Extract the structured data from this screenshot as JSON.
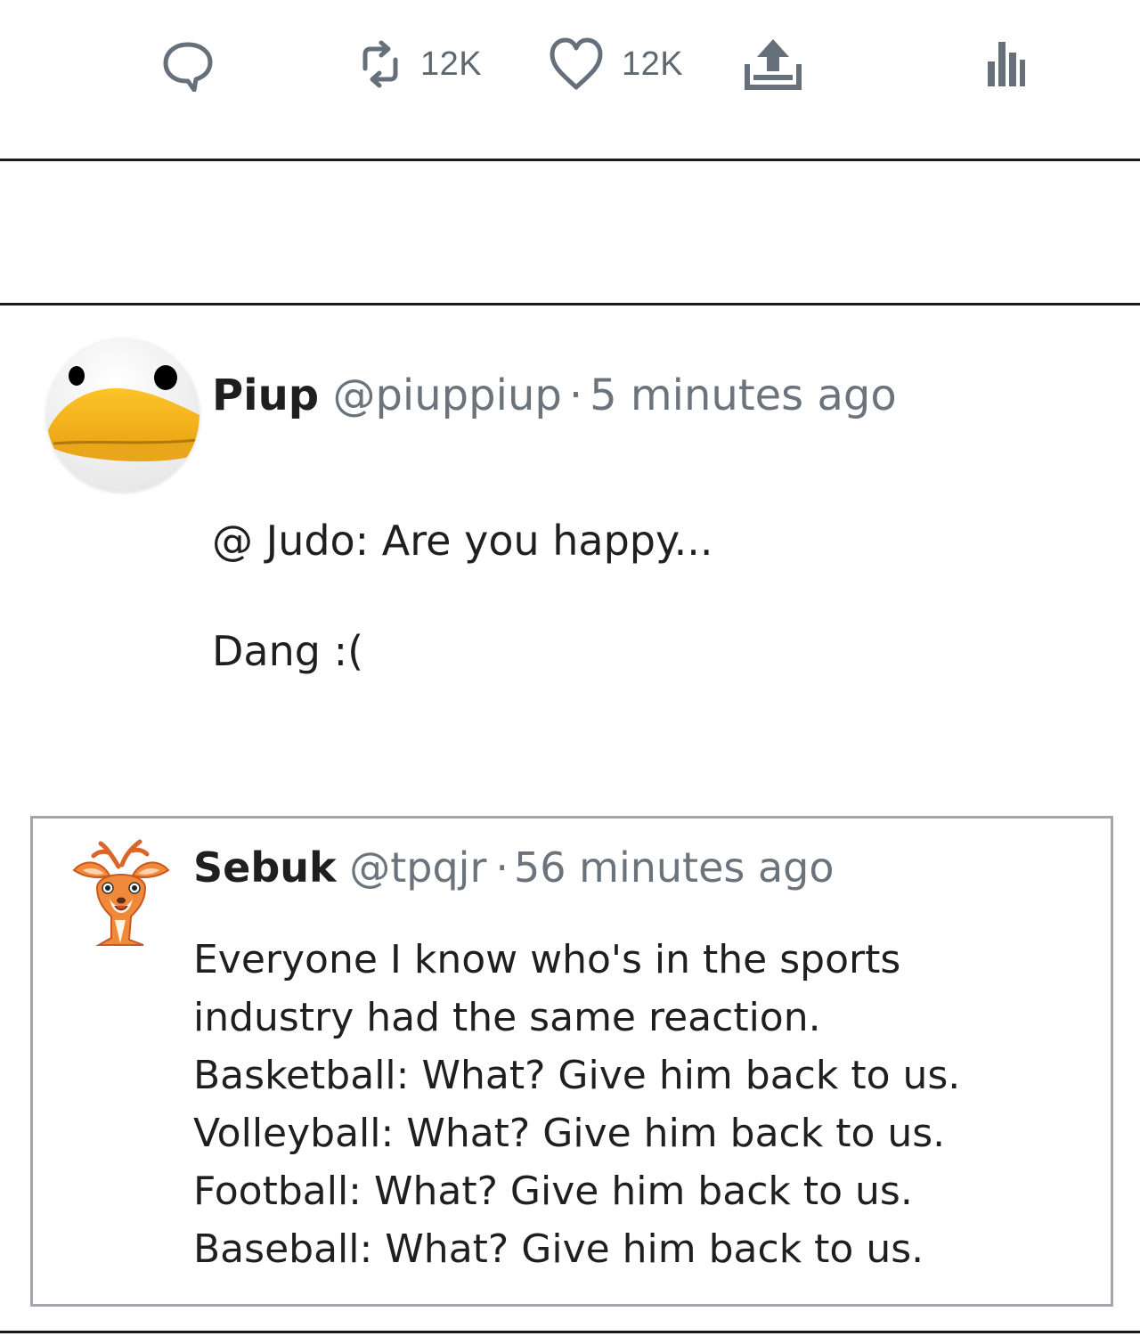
{
  "actions": {
    "retweet_count": "12K",
    "like_count": "12K"
  },
  "tweet": {
    "author_name": "Piup",
    "author_handle": "@piuppiup",
    "separator": "·",
    "timestamp": "5 minutes ago",
    "body_lines": [
      "@ Judo: Are you happy...",
      "Dang :("
    ]
  },
  "quoted_tweet": {
    "author_name": "Sebuk",
    "author_handle": "@tpqjr",
    "separator": "·",
    "timestamp": "56 minutes ago",
    "body_lines": [
      "Everyone I know who's in the sports",
      "industry had the same reaction.",
      "Basketball: What? Give him back to us.",
      "Volleyball: What? Give him back to us.",
      "Football: What? Give him back to us.",
      "Baseball: What? Give him back to us."
    ]
  },
  "icons": {
    "reply": "speech-bubble-icon",
    "retweet": "retweet-icon",
    "like": "heart-icon",
    "share": "share-upload-icon",
    "stats": "bar-chart-icon",
    "main_avatar": "duck-avatar",
    "quote_avatar": "deer-avatar"
  },
  "colors": {
    "icon_gray": "#66707a",
    "text_primary": "#1f1f1f",
    "text_secondary": "#6b737c",
    "quote_border": "#a3a7ab",
    "duck_beak": "#f3b51b"
  }
}
